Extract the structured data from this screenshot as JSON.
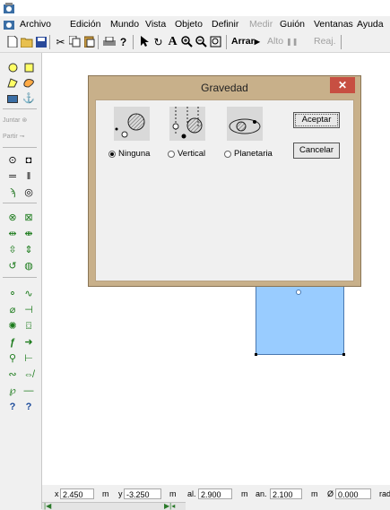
{
  "menubar": {
    "items": [
      {
        "label": "Archivo",
        "disabled": false
      },
      {
        "label": "Edición",
        "disabled": false
      },
      {
        "label": "Mundo",
        "disabled": false
      },
      {
        "label": "Vista",
        "disabled": false
      },
      {
        "label": "Objeto",
        "disabled": false
      },
      {
        "label": "Definir",
        "disabled": false
      },
      {
        "label": "Medir",
        "disabled": true
      },
      {
        "label": "Guión",
        "disabled": false
      },
      {
        "label": "Ventanas",
        "disabled": false
      },
      {
        "label": "Ayuda",
        "disabled": false
      }
    ]
  },
  "toolbar": {
    "run_label": "Arrar",
    "stop_label": "Alto",
    "reset_label": "Reaj."
  },
  "palette": {
    "join_label": "Juntar",
    "split_label": "Partir"
  },
  "dialog": {
    "title": "Gravedad",
    "close_glyph": "✕",
    "options": [
      {
        "label": "Ninguna",
        "selected": true
      },
      {
        "label": "Vertical",
        "selected": false
      },
      {
        "label": "Planetaria",
        "selected": false
      }
    ],
    "accept_label": "Aceptar",
    "cancel_label": "Cancelar"
  },
  "statusbar": {
    "x_label": "x",
    "x_value": "2.450",
    "x_unit": "m",
    "y_label": "y",
    "y_value": "-3.250",
    "y_unit": "m",
    "w_label": "al.",
    "w_value": "2.900",
    "w_unit": "m",
    "h_label": "an.",
    "h_value": "2.100",
    "h_unit": "m",
    "angle_label": "Ø",
    "angle_value": "0.000",
    "angle_unit": "rad"
  },
  "colors": {
    "dialog_frame": "#c8b08a",
    "close_button": "#c74f42",
    "body_fill": "#99ccff"
  }
}
